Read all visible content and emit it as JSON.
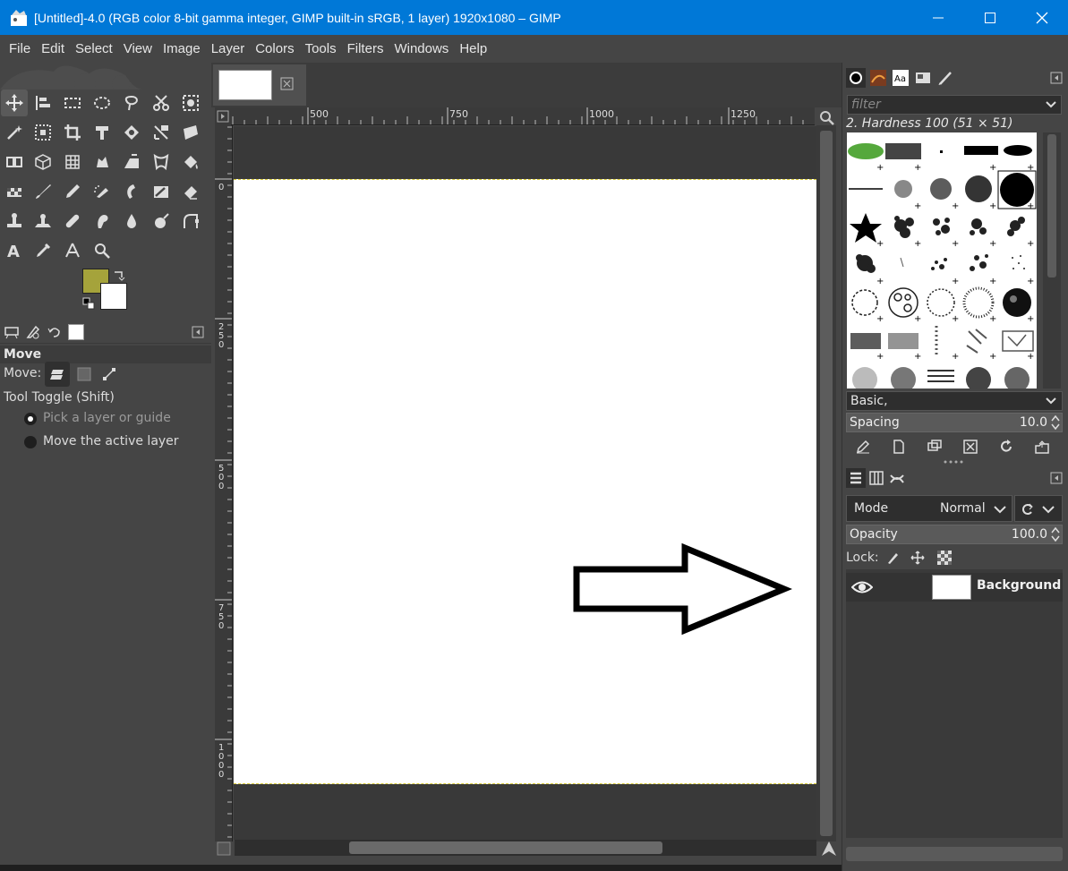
{
  "window": {
    "title": "[Untitled]-4.0 (RGB color 8-bit gamma integer, GIMP built-in sRGB, 1 layer) 1920x1080 – GIMP"
  },
  "menubar": {
    "items": [
      "File",
      "Edit",
      "Select",
      "View",
      "Image",
      "Layer",
      "Colors",
      "Tools",
      "Filters",
      "Windows",
      "Help"
    ]
  },
  "colors": {
    "foreground": "#a5a33b",
    "background": "#ffffff",
    "accent_titlebar": "#0078d7"
  },
  "tool_options": {
    "title": "Move",
    "move_label": "Move:",
    "tool_toggle": "Tool Toggle  (Shift)",
    "option_pick": "Pick a layer or guide",
    "option_move_active": "Move the active layer",
    "selected_option": "pick"
  },
  "ruler": {
    "h_ticks": [
      "500",
      "750",
      "1000",
      "1250"
    ],
    "v_ticks": [
      "0",
      "250",
      "500",
      "750",
      "1000"
    ]
  },
  "brushes": {
    "filter_placeholder": "filter",
    "selected_brush": "2. Hardness 100 (51 × 51)",
    "preset": "Basic,",
    "spacing_label": "Spacing",
    "spacing_value": "10.0"
  },
  "layers": {
    "mode_label": "Mode",
    "mode_value": "Normal",
    "opacity_label": "Opacity",
    "opacity_value": "100.0",
    "lock_label": "Lock:",
    "items": [
      {
        "name": "Background",
        "visible": true
      }
    ]
  }
}
